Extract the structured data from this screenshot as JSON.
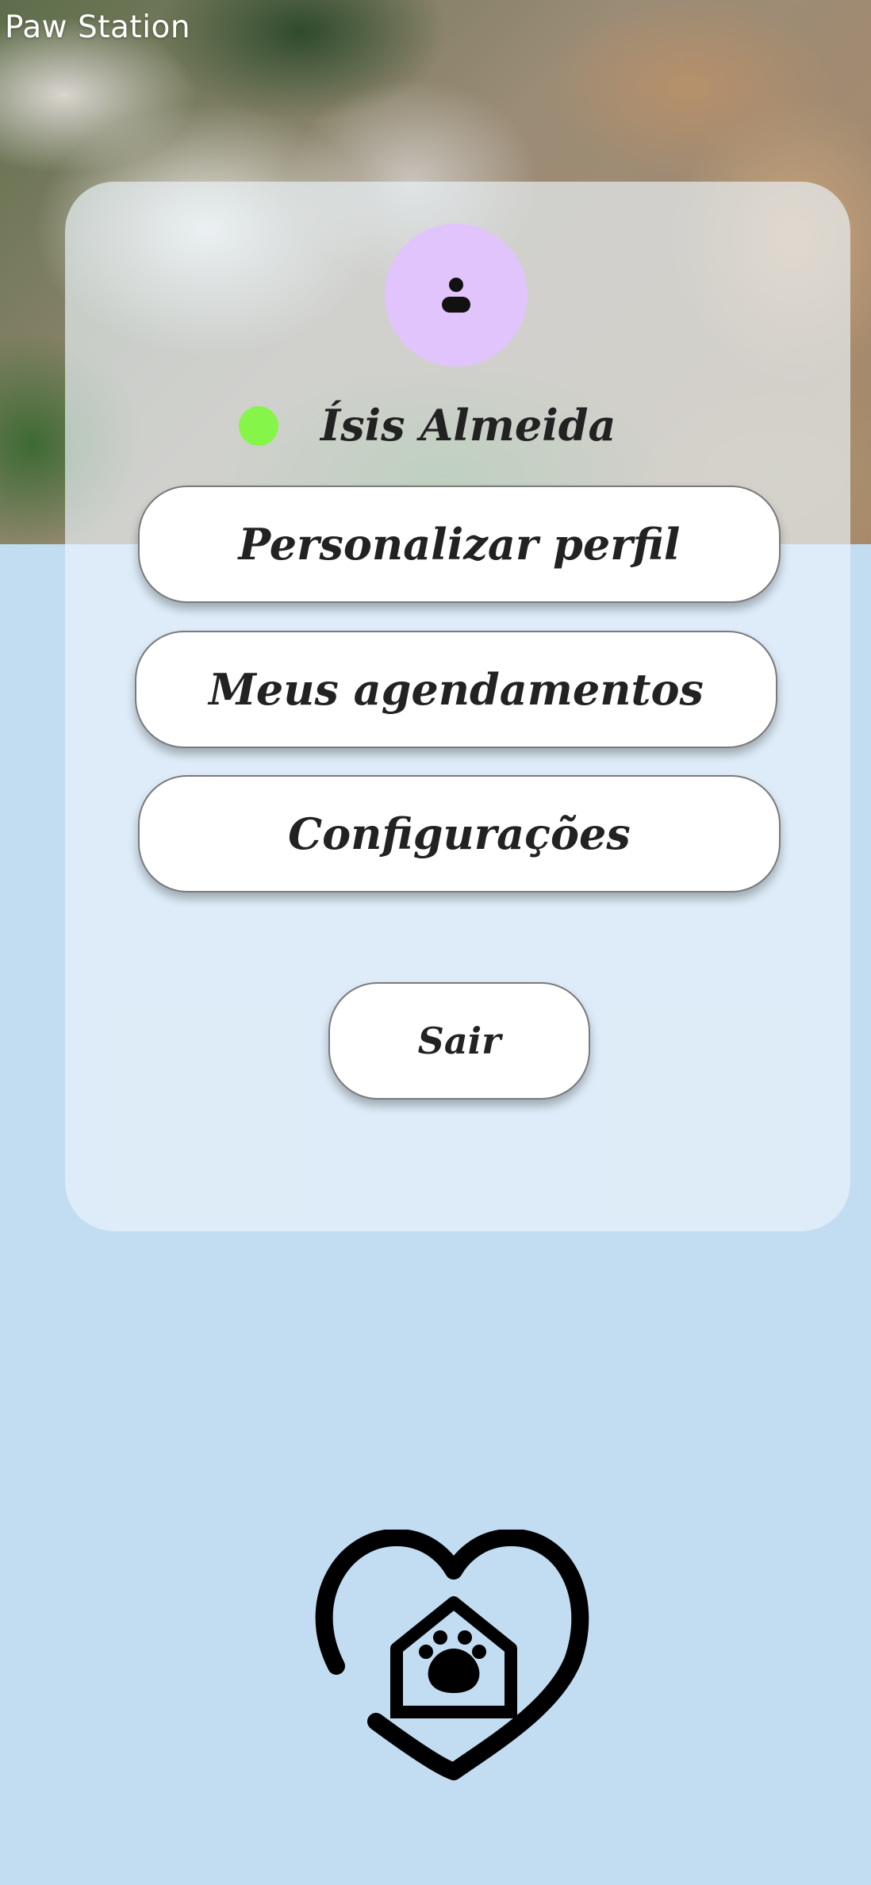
{
  "app": {
    "brand": "Paw Station"
  },
  "profile": {
    "name": "Ísis Almeida",
    "status": "online",
    "status_color": "#86f54a",
    "avatar_color": "#e1c4fb",
    "avatar_icon": "person-icon"
  },
  "menu": {
    "customize_profile": "Personalizar perfil",
    "my_appointments": "Meus agendamentos",
    "settings": "Configurações",
    "logout": "Sair"
  },
  "colors": {
    "background": "#c2ddf2",
    "card": "#ecf4fb",
    "button": "#ffffff",
    "text": "#222222"
  },
  "footer": {
    "logo_icon": "heart-pet-house-logo-icon"
  }
}
